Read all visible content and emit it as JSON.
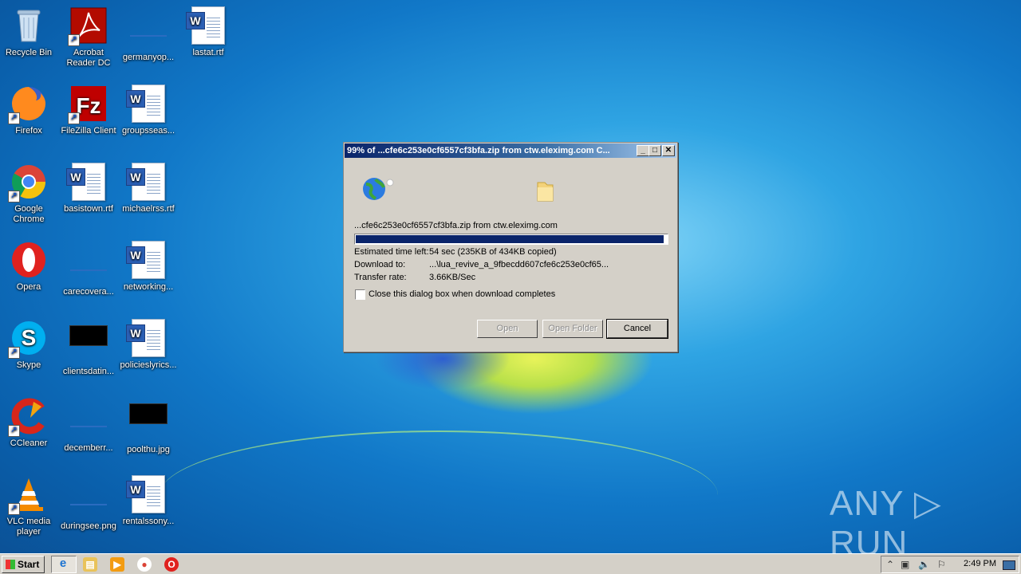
{
  "desktop": {
    "icons": [
      {
        "label": "Recycle Bin"
      },
      {
        "label": "Acrobat Reader DC"
      },
      {
        "label": "germanyop..."
      },
      {
        "label": "lastat.rtf"
      },
      {
        "label": "Firefox"
      },
      {
        "label": "FileZilla Client"
      },
      {
        "label": "groupsseas..."
      },
      {
        "label": "Google Chrome"
      },
      {
        "label": "basistown.rtf"
      },
      {
        "label": "michaelrss.rtf"
      },
      {
        "label": "Opera"
      },
      {
        "label": "carecovera..."
      },
      {
        "label": "networking..."
      },
      {
        "label": "Skype"
      },
      {
        "label": "clientsdatin..."
      },
      {
        "label": "policieslyrics..."
      },
      {
        "label": "CCleaner"
      },
      {
        "label": "decemberr..."
      },
      {
        "label": "poolthu.jpg"
      },
      {
        "label": "VLC media player"
      },
      {
        "label": "duringsee.png"
      },
      {
        "label": "rentalssony..."
      }
    ]
  },
  "dialog": {
    "title": "99% of ...cfe6c253e0cf6557cf3bfa.zip from ctw.eleximg.com C...",
    "source_line": "...cfe6c253e0cf6557cf3bfa.zip from ctw.eleximg.com",
    "progress_fraction": 0.99,
    "rows": [
      {
        "label": "Estimated time left:",
        "value": "54 sec (235KB of 434KB copied)"
      },
      {
        "label": "Download to:",
        "value": "...\\lua_revive_a_9fbecdd607cfe6c253e0cf65..."
      },
      {
        "label": "Transfer rate:",
        "value": "3.66KB/Sec"
      }
    ],
    "checkbox_label": "Close this dialog box when download completes",
    "checkbox_checked": false,
    "buttons": {
      "open": "Open",
      "open_folder": "Open Folder",
      "cancel": "Cancel"
    },
    "title_buttons": {
      "minimize": "_",
      "maximize": "□",
      "close": "✕"
    }
  },
  "taskbar": {
    "start_label": "Start",
    "clock": "2:49 PM"
  },
  "watermark": "ANY ▷ RUN"
}
